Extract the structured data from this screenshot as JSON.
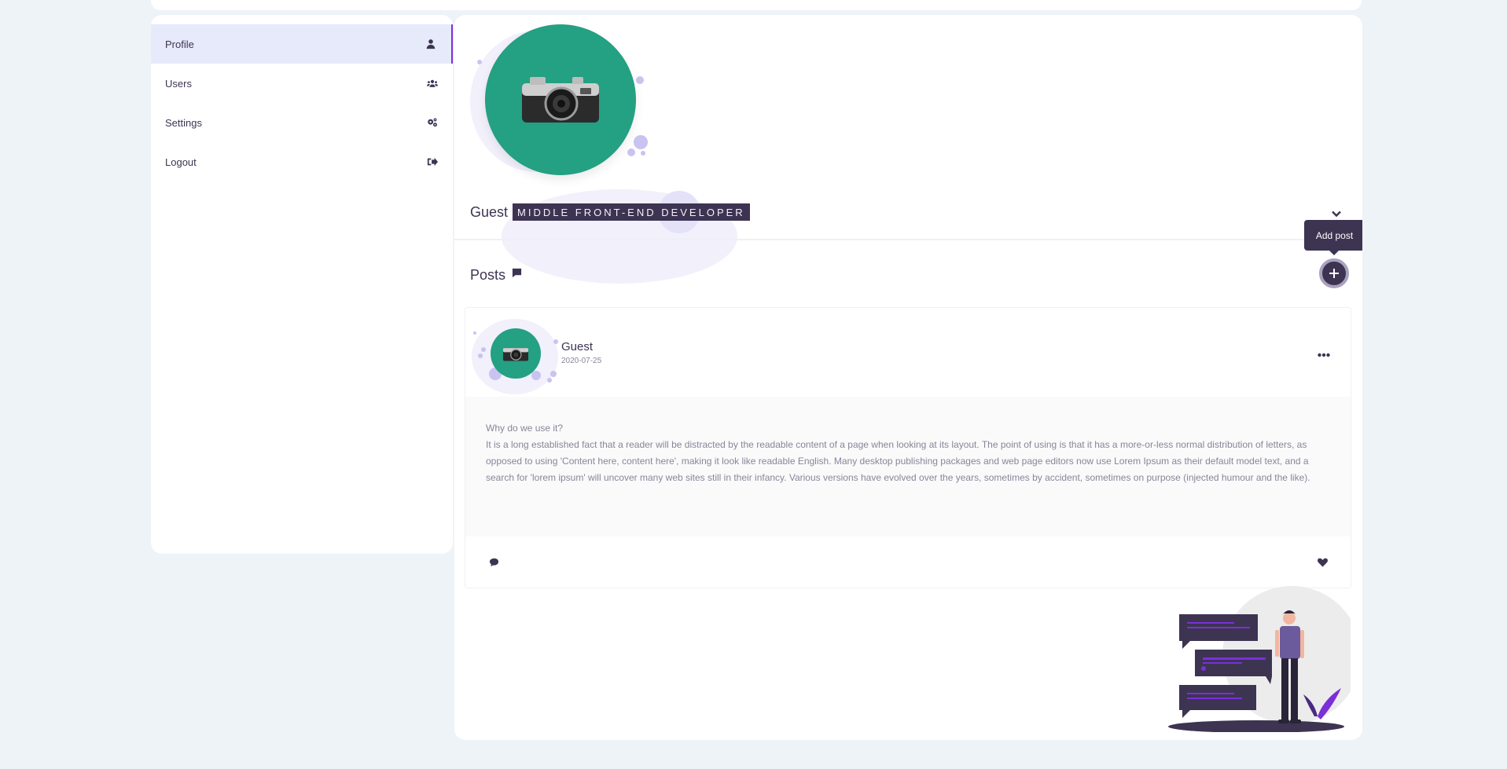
{
  "sidebar": {
    "items": [
      {
        "label": "Profile",
        "icon": "user-icon",
        "active": true
      },
      {
        "label": "Users",
        "icon": "users-icon",
        "active": false
      },
      {
        "label": "Settings",
        "icon": "gears-icon",
        "active": false
      },
      {
        "label": "Logout",
        "icon": "logout-icon",
        "active": false
      }
    ]
  },
  "profile": {
    "name": "Guest",
    "role": "MIDDLE FRONT-END DEVELOPER",
    "avatar_color": "#24a083"
  },
  "posts": {
    "title": "Posts",
    "add_tooltip": "Add post",
    "items": [
      {
        "author": "Guest",
        "date": "2020-07-25",
        "heading": "Why do we use it?",
        "body": "It is a long established fact that a reader will be distracted by the readable content of a page when looking at its layout. The point of using is that it has a more-or-less normal distribution of letters, as opposed to using 'Content here, content here', making it look like readable English. Many desktop publishing packages and web page editors now use Lorem Ipsum as their default model text, and a search for 'lorem ipsum' will uncover many web sites still in their infancy. Various versions have evolved over the years, sometimes by accident, sometimes on purpose (injected humour and the like)."
      }
    ]
  },
  "colors": {
    "primary": "#3d3452",
    "accent": "#7b2fd8",
    "active_bg": "#e6eafb",
    "page_bg": "#eef3f7"
  }
}
